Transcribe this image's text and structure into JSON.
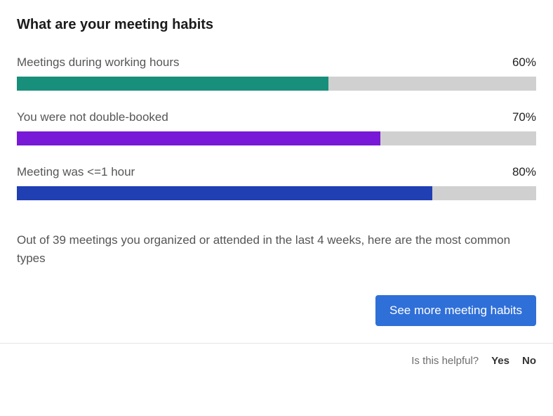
{
  "title": "What are your meeting habits",
  "chart_data": {
    "type": "bar",
    "categories": [
      "Meetings during working hours",
      "You were not double-booked",
      "Meeting was <=1 hour"
    ],
    "values": [
      60,
      70,
      80
    ],
    "series_colors": [
      "#188f7b",
      "#7719d6",
      "#1f3fb3"
    ],
    "xlabel": "",
    "ylabel": "",
    "ylim": [
      0,
      100
    ],
    "title": "What are your meeting habits"
  },
  "habits": [
    {
      "label": "Meetings during working hours",
      "percent": 60,
      "percent_label": "60%",
      "color": "#188f7b"
    },
    {
      "label": "You were not double-booked",
      "percent": 70,
      "percent_label": "70%",
      "color": "#7719d6"
    },
    {
      "label": "Meeting was <=1 hour",
      "percent": 80,
      "percent_label": "80%",
      "color": "#1f3fb3"
    }
  ],
  "summary": "Out of 39 meetings you organized or attended in the last 4 weeks, here are the most common types",
  "cta_label": "See more meeting habits",
  "feedback": {
    "prompt": "Is this helpful?",
    "yes": "Yes",
    "no": "No"
  }
}
